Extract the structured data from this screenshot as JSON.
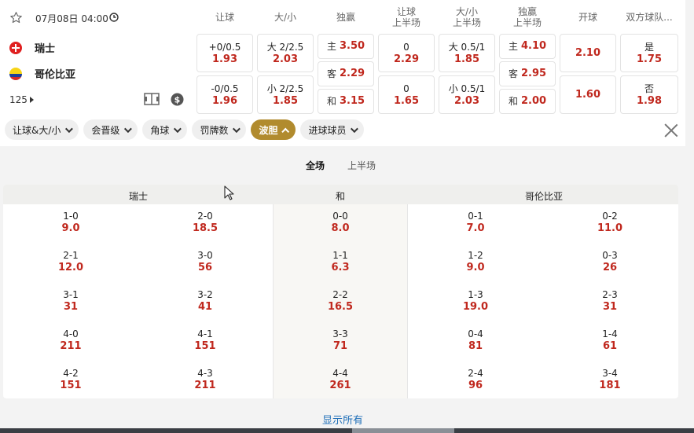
{
  "match": {
    "date_time": "07月08日 04:00",
    "home": "瑞士",
    "away": "哥伦比亚",
    "more_count": "125"
  },
  "headers": [
    "让球",
    "大/小",
    "独赢",
    "让球\n上半场",
    "大/小\n上半场",
    "独赢\n上半场",
    "开球",
    "双方球队..."
  ],
  "odds": {
    "handicap": [
      {
        "line": "+0/0.5",
        "odd": "1.93"
      },
      {
        "line": "-0/0.5",
        "odd": "1.96"
      }
    ],
    "overunder": [
      {
        "line": "大 2/2.5",
        "odd": "2.03"
      },
      {
        "line": "小 2/2.5",
        "odd": "1.85"
      }
    ],
    "moneyline": [
      {
        "label": "主",
        "odd": "3.50"
      },
      {
        "label": "客",
        "odd": "2.29"
      },
      {
        "label": "和",
        "odd": "3.15"
      }
    ],
    "handicap_h1": [
      {
        "line": "0",
        "odd": "2.29"
      },
      {
        "line": "0",
        "odd": "1.65"
      }
    ],
    "overunder_h1": [
      {
        "line": "大 0.5/1",
        "odd": "1.85"
      },
      {
        "line": "小 0.5/1",
        "odd": "2.03"
      }
    ],
    "moneyline_h1": [
      {
        "label": "主",
        "odd": "4.10"
      },
      {
        "label": "客",
        "odd": "2.95"
      },
      {
        "label": "和",
        "odd": "2.00"
      }
    ],
    "kickoff": [
      {
        "odd": "2.10"
      },
      {
        "odd": "1.60"
      }
    ],
    "btts": [
      {
        "label": "是",
        "odd": "1.75"
      },
      {
        "label": "否",
        "odd": "1.98"
      }
    ]
  },
  "filters": [
    {
      "label": "让球&大/小",
      "active": false
    },
    {
      "label": "会晋级",
      "active": false
    },
    {
      "label": "角球",
      "active": false
    },
    {
      "label": "罚牌数",
      "active": false
    },
    {
      "label": "波胆",
      "active": true
    },
    {
      "label": "进球球员",
      "active": false
    }
  ],
  "subtabs": [
    "全场",
    "上半场"
  ],
  "grid_headers": [
    "瑞士",
    "和",
    "哥伦比亚"
  ],
  "scores": {
    "col1": [
      [
        "1-0",
        "9.0"
      ],
      [
        "2-1",
        "12.0"
      ],
      [
        "3-1",
        "31"
      ],
      [
        "4-0",
        "211"
      ],
      [
        "4-2",
        "151"
      ]
    ],
    "col2": [
      [
        "2-0",
        "18.5"
      ],
      [
        "3-0",
        "56"
      ],
      [
        "3-2",
        "41"
      ],
      [
        "4-1",
        "151"
      ],
      [
        "4-3",
        "211"
      ]
    ],
    "col3": [
      [
        "0-0",
        "8.0"
      ],
      [
        "1-1",
        "6.3"
      ],
      [
        "2-2",
        "16.5"
      ],
      [
        "3-3",
        "71"
      ],
      [
        "4-4",
        "261"
      ]
    ],
    "col4": [
      [
        "0-1",
        "7.0"
      ],
      [
        "1-2",
        "9.0"
      ],
      [
        "1-3",
        "19.0"
      ],
      [
        "0-4",
        "81"
      ],
      [
        "2-4",
        "96"
      ]
    ],
    "col5": [
      [
        "0-2",
        "11.0"
      ],
      [
        "0-3",
        "26"
      ],
      [
        "2-3",
        "31"
      ],
      [
        "1-4",
        "61"
      ],
      [
        "3-4",
        "181"
      ]
    ]
  },
  "show_all": "显示所有",
  "icons": [
    "star-icon",
    "clock-icon",
    "pitch-icon",
    "dollar-icon",
    "close-icon",
    "chevron-right-icon"
  ]
}
